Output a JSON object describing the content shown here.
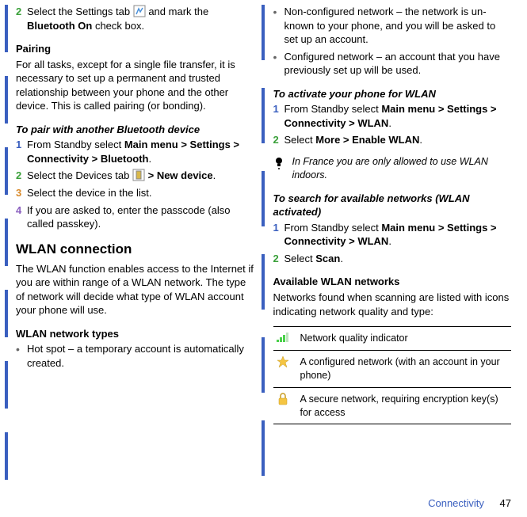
{
  "left": {
    "step2_pre": "Select the Settings tab ",
    "step2_post": " and mark the ",
    "step2_bold": "Bluetooth On",
    "step2_tail": " check box.",
    "pairing_head": "Pairing",
    "pairing_body": "For all tasks, except for a single file transfer, it is necessary to set up a permanent and trusted relationship between your phone and the other device. This is called pairing (or bonding).",
    "pair_head": "To pair with another Bluetooth device",
    "p1_pre": "From Standby select ",
    "p1_bold": "Main menu > Settings > Connectivity > Bluetooth",
    "p1_tail": ".",
    "p2_pre": "Select the Devices tab ",
    "p2_mid": " > ",
    "p2_bold": "New device",
    "p2_tail": ".",
    "p3": "Select the device in the list.",
    "p4": "If you are asked to, enter the passcode (also called passkey).",
    "wlan_head": "WLAN connection",
    "wlan_body": "The WLAN function enables access to the Internet if you are within range of a WLAN network. The type of network will decide what type of WLAN account your phone will use.",
    "wlan_types_head": "WLAN network types",
    "hotspot_pre": "Hot spot ",
    "hotspot_dash": "– ",
    "hotspot_tail": "a temporary account is automatically created."
  },
  "right": {
    "nonconf_pre": "Non-configured network ",
    "nonconf_dash": "– ",
    "nonconf_tail": "the network is un-known to your phone, and you will be asked to set up an account.",
    "conf_pre": "Configured network ",
    "conf_dash": "– ",
    "conf_tail": "an account that you have previously set up will be used.",
    "activate_head": "To activate your phone for WLAN",
    "a1_pre": "From Standby select ",
    "a1_bold": "Main menu > Settings > Connectivity > WLAN",
    "a1_tail": ".",
    "a2_pre": "Select ",
    "a2_bold": "More > Enable WLAN",
    "a2_tail": ".",
    "tip": "In France you are only allowed to use WLAN indoors.",
    "search_head": "To search for available networks (WLAN activated)",
    "s1_pre": "From Standby select ",
    "s1_bold": "Main menu > Settings > Connectivity > WLAN",
    "s1_tail": ".",
    "s2_pre": "Select ",
    "s2_bold": "Scan",
    "s2_tail": ".",
    "avail_head": "Available WLAN networks",
    "avail_body": "Networks found when scanning are listed with icons indicating network quality and type:",
    "tbl1": "Network quality indicator",
    "tbl2": "A configured network (with an account in your phone)",
    "tbl3": "A secure network, requiring encryption key(s) for access"
  },
  "footer": {
    "label": "Connectivity",
    "page": "47"
  },
  "nums": {
    "n1": "1",
    "n2": "2",
    "n3": "3",
    "n4": "4"
  }
}
